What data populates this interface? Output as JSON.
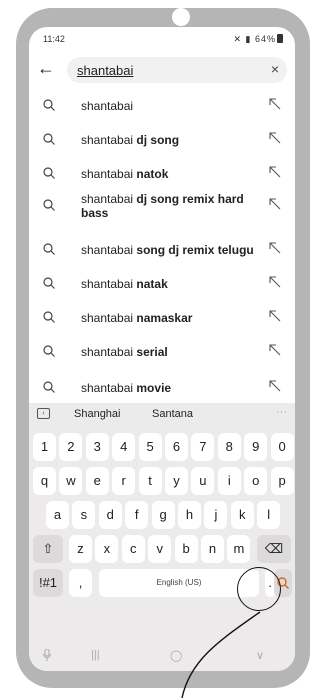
{
  "status": {
    "time": "11:42",
    "battery": "64%"
  },
  "search": {
    "query": "shantabai",
    "clear": "×",
    "back": "←"
  },
  "suggestions": [
    {
      "prefix": "shantabai",
      "suffix": ""
    },
    {
      "prefix": "shantabai",
      "suffix": "dj song"
    },
    {
      "prefix": "shantabai",
      "suffix": "natok"
    },
    {
      "prefix": "shantabai",
      "suffix": "dj song remix hard bass"
    },
    {
      "prefix": "shantabai",
      "suffix": "song dj remix telugu"
    },
    {
      "prefix": "shantabai",
      "suffix": "natak"
    },
    {
      "prefix": "shantabai",
      "suffix": "namaskar"
    },
    {
      "prefix": "shantabai",
      "suffix": "serial"
    },
    {
      "prefix": "shantabai",
      "suffix": "movie"
    }
  ],
  "keyboard": {
    "predictions": [
      "Shanghai",
      "Santana"
    ],
    "pred_more": "···",
    "numbers": [
      "1",
      "2",
      "3",
      "4",
      "5",
      "6",
      "7",
      "8",
      "9",
      "0"
    ],
    "row1": [
      "q",
      "w",
      "e",
      "r",
      "t",
      "y",
      "u",
      "i",
      "o",
      "p"
    ],
    "row2": [
      "a",
      "s",
      "d",
      "f",
      "g",
      "h",
      "j",
      "k",
      "l"
    ],
    "row3": [
      "z",
      "x",
      "c",
      "v",
      "b",
      "n",
      "m"
    ],
    "shift": "⇧",
    "backspace": "⌫",
    "symbols": "!#1",
    "comma": ",",
    "space": "English (US)",
    "period": ".",
    "search_key": "search"
  },
  "navbar": {
    "back": "‹",
    "home": "◯",
    "recents": "|||",
    "mic": "🎙",
    "hide": "∨"
  }
}
